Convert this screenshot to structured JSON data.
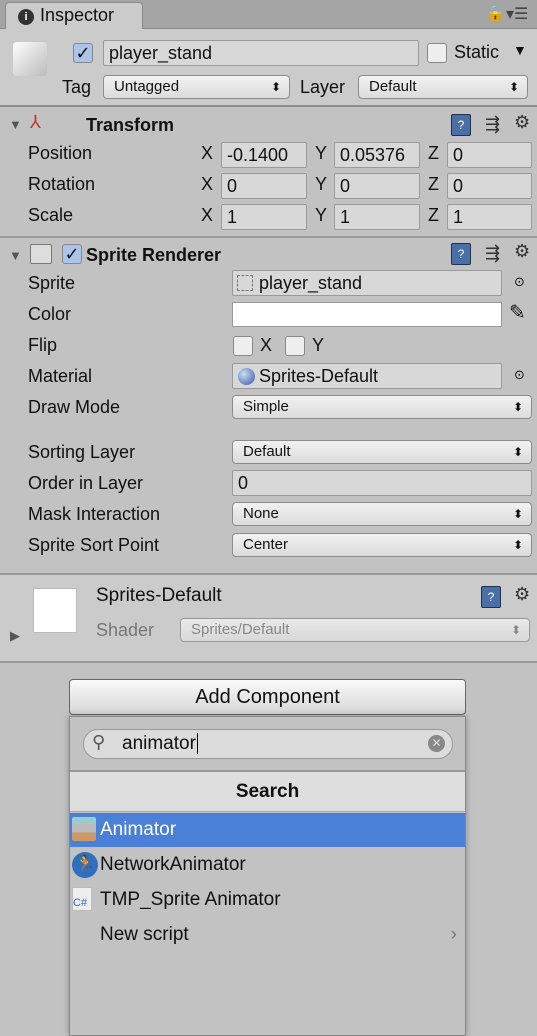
{
  "tab": {
    "title": "Inspector"
  },
  "object": {
    "active": true,
    "name": "player_stand",
    "static_label": "Static",
    "static": false,
    "tag_label": "Tag",
    "tag": "Untagged",
    "layer_label": "Layer",
    "layer": "Default"
  },
  "transform": {
    "title": "Transform",
    "rows": [
      {
        "label": "Position",
        "x": "-0.1400",
        "y": "0.05376",
        "z": "0"
      },
      {
        "label": "Rotation",
        "x": "0",
        "y": "0",
        "z": "0"
      },
      {
        "label": "Scale",
        "x": "1",
        "y": "1",
        "z": "1"
      }
    ],
    "axes": [
      "X",
      "Y",
      "Z"
    ]
  },
  "sprite_renderer": {
    "title": "Sprite Renderer",
    "enabled": true,
    "sprite_label": "Sprite",
    "sprite": "player_stand",
    "color_label": "Color",
    "color": "#ffffff",
    "flip_label": "Flip",
    "flip_x": "X",
    "flip_y": "Y",
    "material_label": "Material",
    "material": "Sprites-Default",
    "draw_mode_label": "Draw Mode",
    "draw_mode": "Simple",
    "sorting_layer_label": "Sorting Layer",
    "sorting_layer": "Default",
    "order_label": "Order in Layer",
    "order": "0",
    "mask_label": "Mask Interaction",
    "mask": "None",
    "sort_point_label": "Sprite Sort Point",
    "sort_point": "Center"
  },
  "material": {
    "name": "Sprites-Default",
    "shader_label": "Shader",
    "shader": "Sprites/Default"
  },
  "add_component": {
    "label": "Add Component",
    "search_value": "animator",
    "section": "Search",
    "items": [
      {
        "label": "Animator",
        "icon": "animator-icon",
        "selected": true
      },
      {
        "label": "NetworkAnimator",
        "icon": "network-animator-icon"
      },
      {
        "label": "TMP_Sprite Animator",
        "icon": "csharp-script-icon"
      },
      {
        "label": "New script",
        "icon": "none"
      }
    ]
  },
  "colors": {
    "selection": "#4a80d8",
    "panel": "#c2c2c2"
  }
}
